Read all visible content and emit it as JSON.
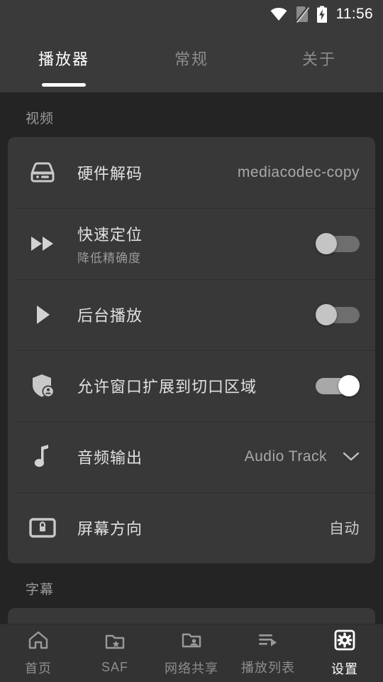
{
  "statusbar": {
    "time": "11:56",
    "icons": [
      "wifi-icon",
      "sim-card-off-icon",
      "battery-charging-icon"
    ]
  },
  "tabs": [
    {
      "label": "播放器",
      "active": true
    },
    {
      "label": "常规",
      "active": false
    },
    {
      "label": "关于",
      "active": false
    }
  ],
  "sections": [
    {
      "header": "视频",
      "rows": [
        {
          "icon": "hard-drive-icon",
          "title": "硬件解码",
          "sub": "",
          "value": "mediacodec-copy",
          "control": "value"
        },
        {
          "icon": "fast-forward-icon",
          "title": "快速定位",
          "sub": "降低精确度",
          "value": "",
          "control": "switch-off"
        },
        {
          "icon": "play-icon",
          "title": "后台播放",
          "sub": "",
          "value": "",
          "control": "switch-off"
        },
        {
          "icon": "shield-person-icon",
          "title": "允许窗口扩展到切口区域",
          "sub": "",
          "value": "",
          "control": "switch-on"
        },
        {
          "icon": "music-note-icon",
          "title": "音频输出",
          "sub": "",
          "value": "Audio Track",
          "control": "dropdown"
        },
        {
          "icon": "screen-lock-rotation-icon",
          "title": "屏幕方向",
          "sub": "",
          "value": "自动",
          "control": "value"
        }
      ]
    },
    {
      "header": "字幕",
      "rows": []
    }
  ],
  "bottomnav": [
    {
      "icon": "home-icon",
      "label": "首页",
      "active": false
    },
    {
      "icon": "folder-star-icon",
      "label": "SAF",
      "active": false
    },
    {
      "icon": "folder-shared-icon",
      "label": "网络共享",
      "active": false
    },
    {
      "icon": "playlist-play-icon",
      "label": "播放列表",
      "active": false
    },
    {
      "icon": "settings-gear-icon",
      "label": "设置",
      "active": true
    }
  ],
  "colors": {
    "page_background": "#242424",
    "card_background": "#383838",
    "bar_background": "#3a3a3a",
    "nav_background": "#333333",
    "active_text": "#ffffff",
    "inactive_text": "#8d8d8d",
    "title_text": "#e0e0e0",
    "value_text": "#a8a8a8",
    "switch_on_track": "#a8a8a8",
    "switch_off_track": "#6e6e6e"
  }
}
